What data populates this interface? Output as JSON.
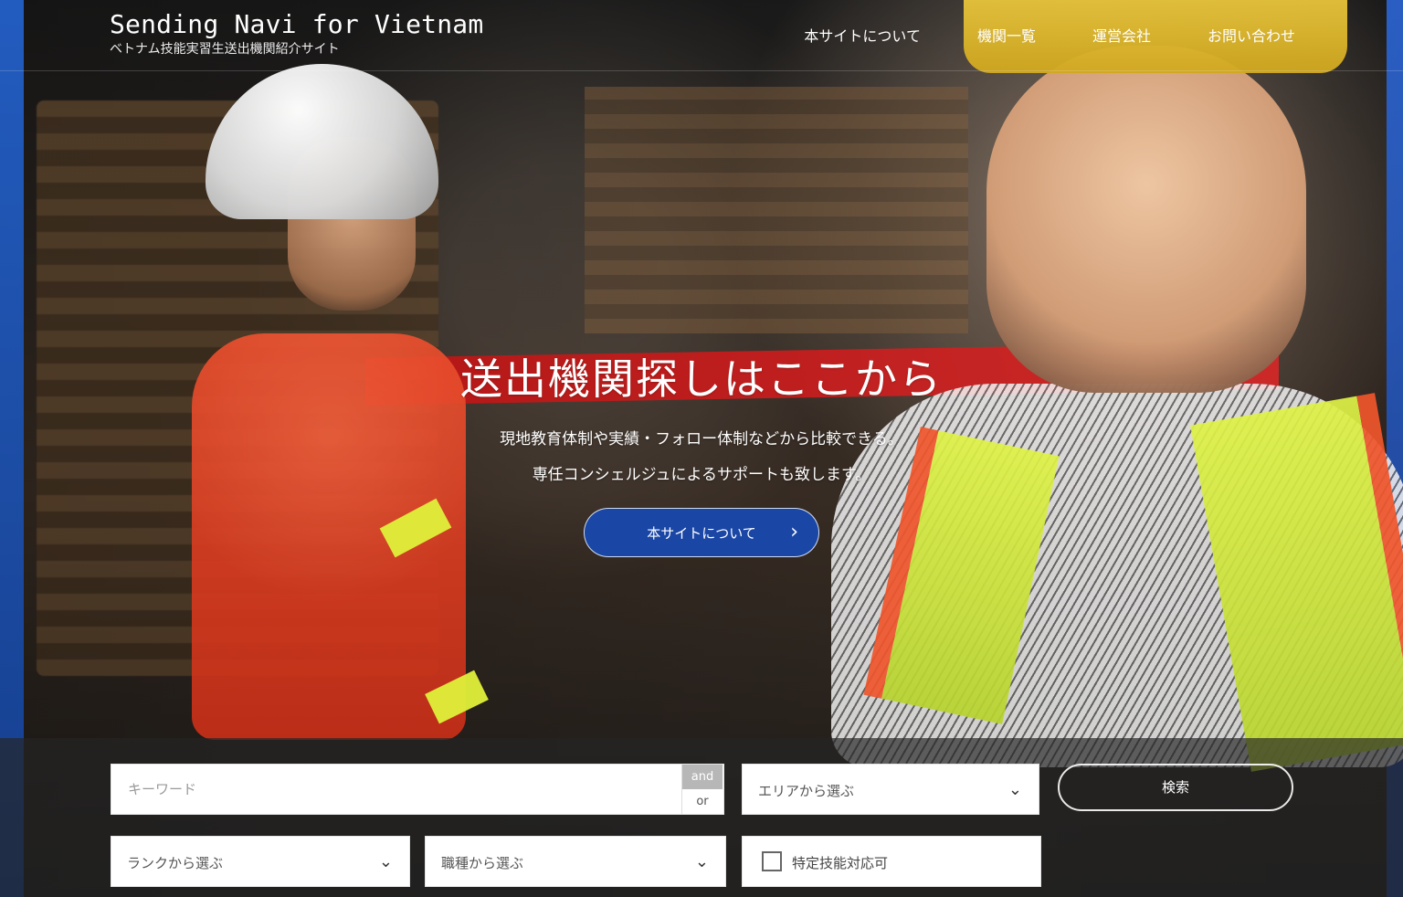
{
  "header": {
    "title": "Sending Navi for Vietnam",
    "subtitle": "ベトナム技能実習生送出機関紹介サイト",
    "nav": [
      {
        "label": "本サイトについて"
      },
      {
        "label": "機関一覧"
      },
      {
        "label": "運営会社"
      },
      {
        "label": "お問い合わせ"
      }
    ]
  },
  "hero": {
    "title": "送出機関探しはここから",
    "description_line_1": "現地教育体制や実績・フォロー体制などから比較できる。",
    "description_line_2": "専任コンシェルジュによるサポートも致します。",
    "button_label": "本サイトについて",
    "button_arrow": "›"
  },
  "search": {
    "keyword_placeholder": "キーワード",
    "toggle_and": "and",
    "toggle_or": "or",
    "area_label": "エリアから選ぶ",
    "rank_label": "ランクから選ぶ",
    "job_label": "職種から選ぶ",
    "specific_skill_label": "特定技能対応可",
    "search_button_label": "検索",
    "chevron": "⌄"
  },
  "colors": {
    "primary_button": "#1a46a5",
    "search_panel": "#252525"
  }
}
